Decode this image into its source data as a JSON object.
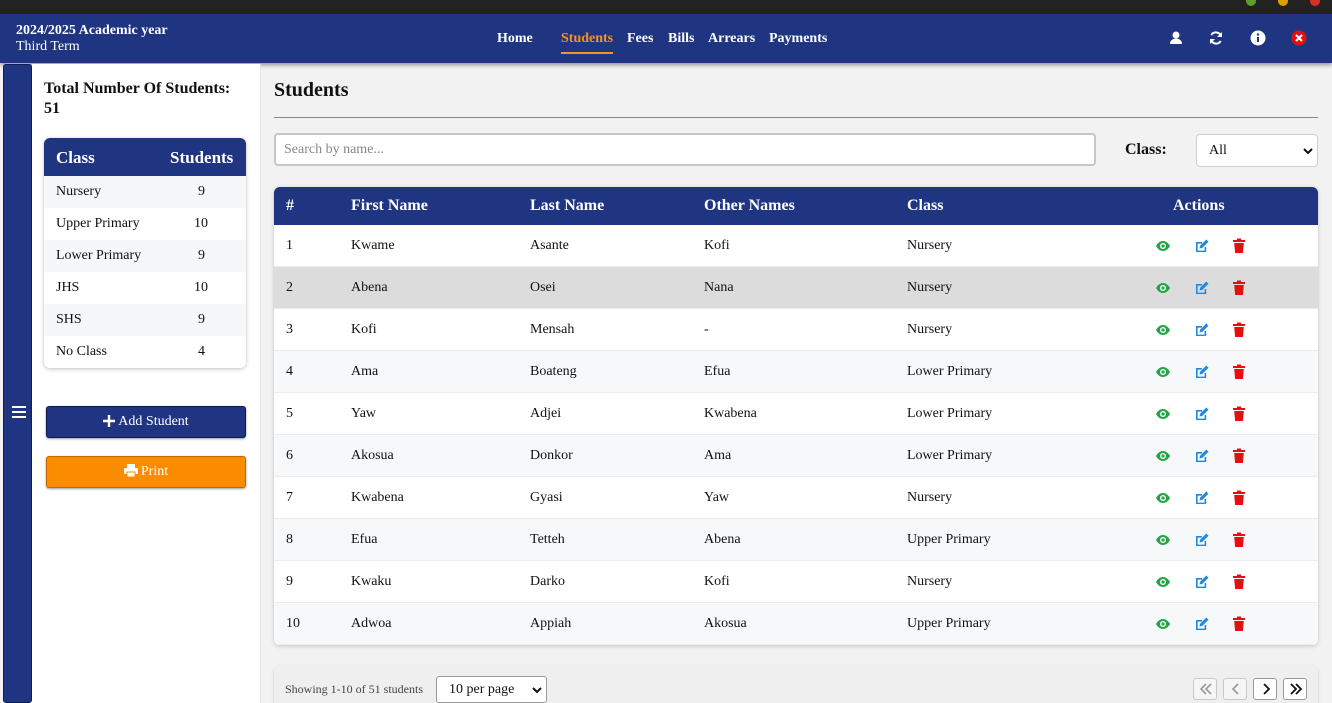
{
  "header": {
    "academic_year": "2024/2025 Academic year",
    "term": "Third Term",
    "nav": [
      {
        "label": "Home",
        "active": false
      },
      {
        "label": "Students",
        "active": true
      },
      {
        "label": "Fees",
        "active": false
      },
      {
        "label": "Bills",
        "active": false
      },
      {
        "label": "Arrears",
        "active": false
      },
      {
        "label": "Payments",
        "active": false
      }
    ],
    "icons": [
      "user-icon",
      "refresh-icon",
      "info-icon",
      "close-icon"
    ],
    "accent_color": "#f7931e",
    "brand_color": "#1f3582"
  },
  "sidebar": {
    "total_label": "Total Number Of Students:",
    "total_value": "51",
    "class_table": {
      "headers": [
        "Class",
        "Students"
      ],
      "rows": [
        {
          "class": "Nursery",
          "count": "9"
        },
        {
          "class": "Upper Primary",
          "count": "10"
        },
        {
          "class": "Lower Primary",
          "count": "9"
        },
        {
          "class": "JHS",
          "count": "10"
        },
        {
          "class": "SHS",
          "count": "9"
        },
        {
          "class": "No Class",
          "count": "4"
        }
      ]
    },
    "add_button": "Add Student",
    "print_button": "Print"
  },
  "main": {
    "title": "Students",
    "search_placeholder": "Search by name...",
    "search_value": "",
    "class_filter_label": "Class:",
    "class_filter_value": "All",
    "table": {
      "headers": [
        "#",
        "First Name",
        "Last Name",
        "Other Names",
        "Class",
        "Actions"
      ],
      "rows": [
        {
          "num": "1",
          "first": "Kwame",
          "last": "Asante",
          "other": "Kofi",
          "class": "Nursery"
        },
        {
          "num": "2",
          "first": "Abena",
          "last": "Osei",
          "other": "Nana",
          "class": "Nursery"
        },
        {
          "num": "3",
          "first": "Kofi",
          "last": "Mensah",
          "other": "-",
          "class": "Nursery"
        },
        {
          "num": "4",
          "first": "Ama",
          "last": "Boateng",
          "other": "Efua",
          "class": "Lower Primary"
        },
        {
          "num": "5",
          "first": "Yaw",
          "last": "Adjei",
          "other": "Kwabena",
          "class": "Lower Primary"
        },
        {
          "num": "6",
          "first": "Akosua",
          "last": "Donkor",
          "other": "Ama",
          "class": "Lower Primary"
        },
        {
          "num": "7",
          "first": "Kwabena",
          "last": "Gyasi",
          "other": "Yaw",
          "class": "Nursery"
        },
        {
          "num": "8",
          "first": "Efua",
          "last": "Tetteh",
          "other": "Abena",
          "class": "Upper Primary"
        },
        {
          "num": "9",
          "first": "Kwaku",
          "last": "Darko",
          "other": "Kofi",
          "class": "Nursery"
        },
        {
          "num": "10",
          "first": "Adwoa",
          "last": "Appiah",
          "other": "Akosua",
          "class": "Upper Primary"
        }
      ],
      "action_icons": [
        "eye-icon",
        "edit-icon",
        "trash-icon"
      ],
      "action_colors": {
        "view": "#22a447",
        "edit": "#1e88e5",
        "delete": "#e41010"
      }
    },
    "footer": {
      "showing": "Showing 1-10 of 51 students",
      "per_page": "10 per page"
    }
  }
}
